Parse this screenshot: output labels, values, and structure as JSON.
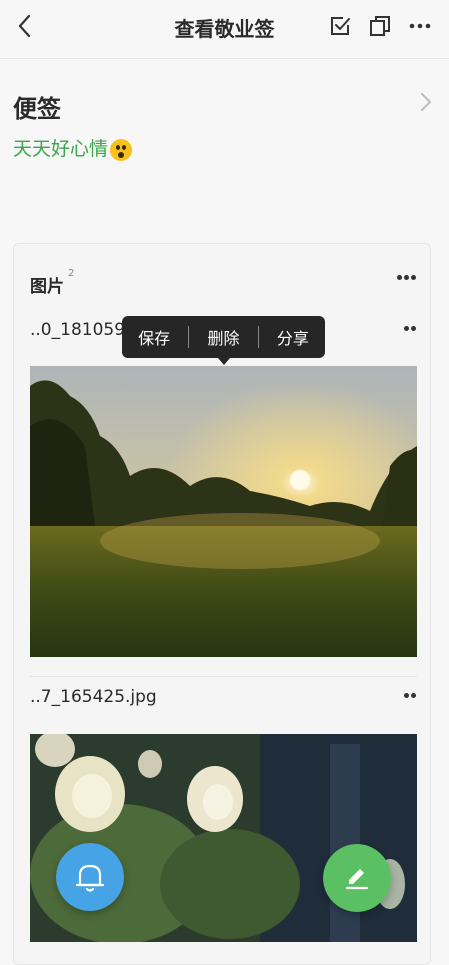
{
  "header": {
    "title": "查看敬业签",
    "icons": [
      "back-icon",
      "checkbox-icon",
      "copy-icon",
      "more-icon"
    ]
  },
  "note": {
    "category": "便签",
    "content": "天天好心情"
  },
  "attachments": {
    "title": "图片",
    "count": "2",
    "files": [
      {
        "name": "..0_181059.jpg"
      },
      {
        "name": "..7_165425.jpg"
      }
    ]
  },
  "popup_menu": {
    "items": [
      "保存",
      "删除",
      "分享"
    ]
  },
  "colors": {
    "accent_green": "#3aa54a",
    "fab_blue": "#46a3e6",
    "fab_green": "#5bbf63"
  }
}
